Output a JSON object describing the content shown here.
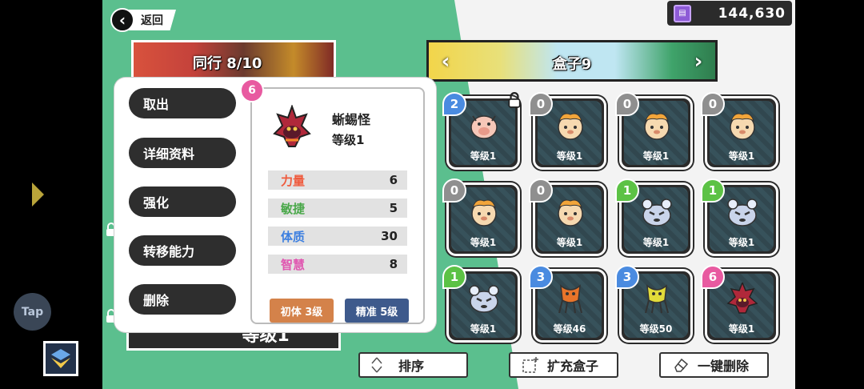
{
  "nav": {
    "back_label": "返回"
  },
  "currency": {
    "value": "144,630",
    "icon": "gem-icon"
  },
  "team": {
    "label": "同行 8/10"
  },
  "level_panel": {
    "label": "等级1"
  },
  "box": {
    "title": "盒子9",
    "prev": "‹",
    "next": "›"
  },
  "side": {
    "tap_label": "Tap"
  },
  "popup": {
    "menu": [
      {
        "label": "取出",
        "name": "take-out-button"
      },
      {
        "label": "详细资料",
        "name": "details-button"
      },
      {
        "label": "强化",
        "name": "enhance-button"
      },
      {
        "label": "转移能力",
        "name": "transfer-ability-button"
      },
      {
        "label": "删除",
        "name": "delete-button"
      }
    ],
    "count": "6",
    "monster_name": "蜥蜴怪",
    "monster_level": "等级1",
    "stats": [
      {
        "label": "力量",
        "value": "6",
        "color": "#ef5a3c"
      },
      {
        "label": "敏捷",
        "value": "5",
        "color": "#4aa84a"
      },
      {
        "label": "体质",
        "value": "30",
        "color": "#3c7fe0"
      },
      {
        "label": "智慧",
        "value": "8",
        "color": "#e056b0"
      }
    ],
    "traits": [
      {
        "label": "初体 3级",
        "color": "#d4824a"
      },
      {
        "label": "精准 5级",
        "color": "#3e5a8c"
      }
    ]
  },
  "monsters": [
    {
      "count": "2",
      "badge": "blue",
      "level": "等级1",
      "kind": "pig",
      "locked": true
    },
    {
      "count": "0",
      "badge": "gray",
      "level": "等级1",
      "kind": "puff"
    },
    {
      "count": "0",
      "badge": "gray",
      "level": "等级1",
      "kind": "puff"
    },
    {
      "count": "0",
      "badge": "gray",
      "level": "等级1",
      "kind": "puff"
    },
    {
      "count": "0",
      "badge": "gray",
      "level": "等级1",
      "kind": "puff"
    },
    {
      "count": "0",
      "badge": "gray",
      "level": "等级1",
      "kind": "puff"
    },
    {
      "count": "1",
      "badge": "green",
      "level": "等级1",
      "kind": "mouse"
    },
    {
      "count": "1",
      "badge": "green",
      "level": "等级1",
      "kind": "mouse"
    },
    {
      "count": "1",
      "badge": "green",
      "level": "等级1",
      "kind": "mouse"
    },
    {
      "count": "3",
      "badge": "blue",
      "level": "等级46",
      "kind": "crab-orange"
    },
    {
      "count": "3",
      "badge": "blue",
      "level": "等级50",
      "kind": "crab-yellow"
    },
    {
      "count": "6",
      "badge": "pink",
      "level": "等级1",
      "kind": "lizard"
    }
  ],
  "buttons": {
    "sort": "排序",
    "expand": "扩充盒子",
    "delete_all": "一键删除"
  }
}
